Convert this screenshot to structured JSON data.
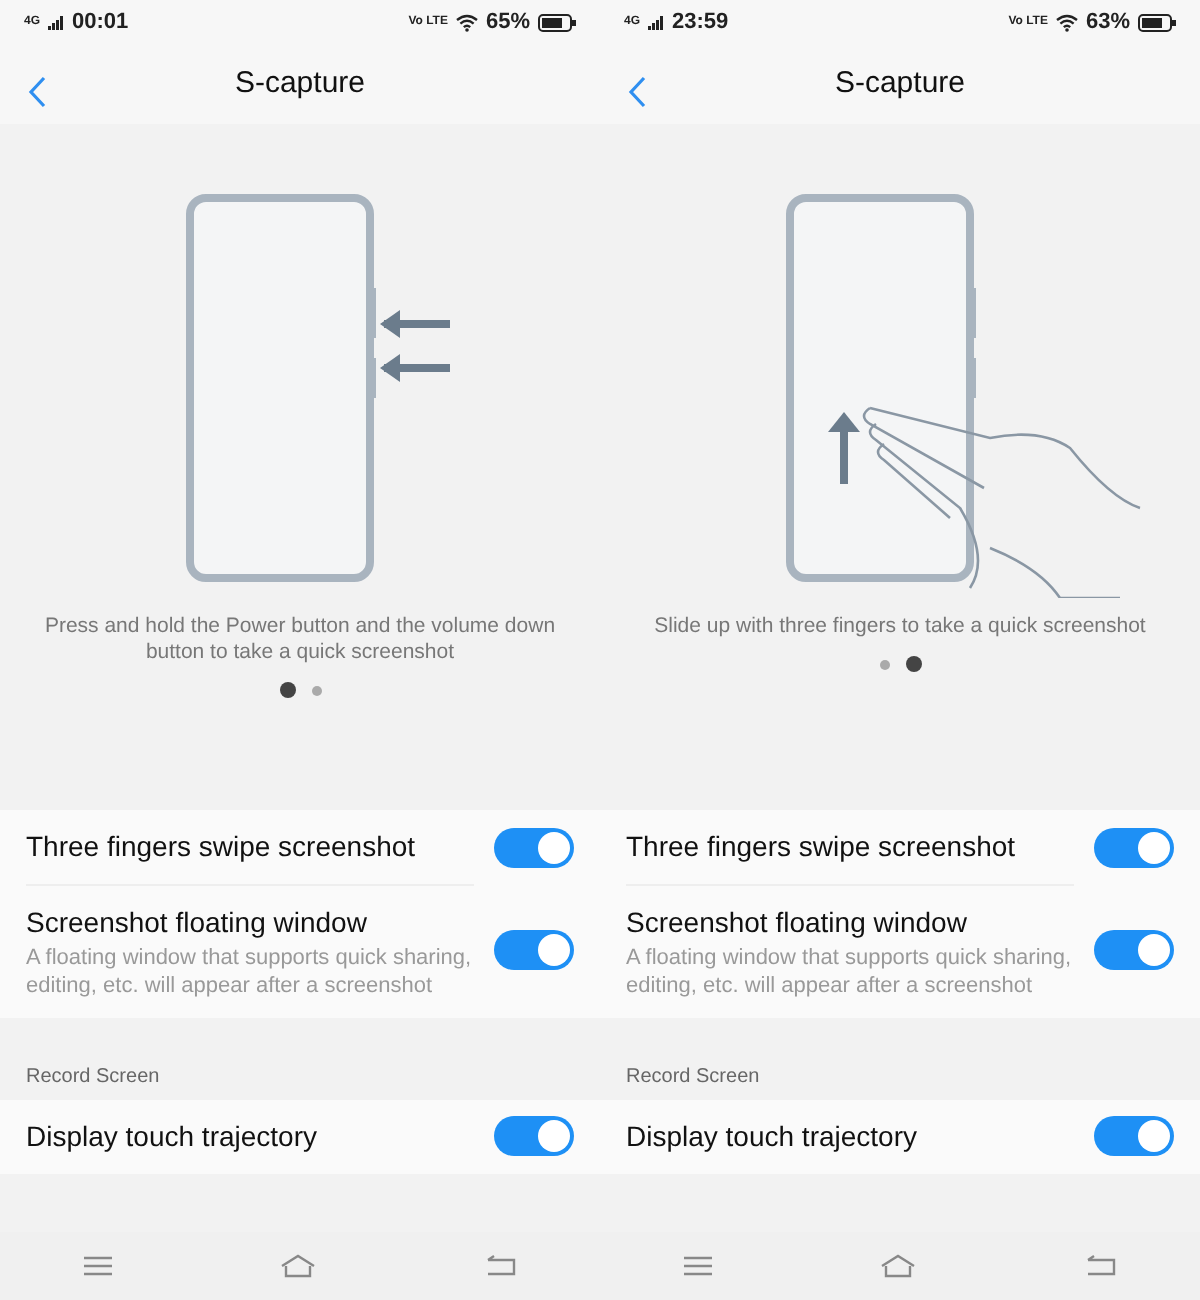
{
  "screens": [
    {
      "status_bar": {
        "network": "4G",
        "time": "00:01",
        "volte": "Vo LTE",
        "battery": "65%"
      },
      "title": "S-capture",
      "illustration": {
        "kind": "side-press",
        "caption": "Press and hold the Power button and the volume down button to take a quick screenshot"
      },
      "pager": [
        {
          "selected": true
        },
        {
          "selected": false
        }
      ],
      "settings": [
        {
          "title": "Three fingers swipe screenshot",
          "on": true
        },
        {
          "title": "Screenshot floating window",
          "description": "A floating window that supports quick sharing, editing, etc. will appear after a screenshot",
          "on": true
        }
      ],
      "section": "Record Screen",
      "record_settings": [
        {
          "title": "Display touch trajectory",
          "on": true
        }
      ]
    },
    {
      "status_bar": {
        "network": "4G",
        "time": "23:59",
        "volte": "Vo LTE",
        "battery": "63%"
      },
      "title": "S-capture",
      "illustration": {
        "kind": "three-finger-swipe",
        "caption": "Slide up with three fingers to take a quick screenshot"
      },
      "pager": [
        {
          "selected": false
        },
        {
          "selected": true
        }
      ],
      "settings": [
        {
          "title": "Three fingers swipe screenshot",
          "on": true
        },
        {
          "title": "Screenshot floating window",
          "description": "A floating window that supports quick sharing, editing, etc. will appear after a screenshot",
          "on": true
        }
      ],
      "section": "Record Screen",
      "record_settings": [
        {
          "title": "Display touch trajectory",
          "on": true
        }
      ]
    }
  ]
}
